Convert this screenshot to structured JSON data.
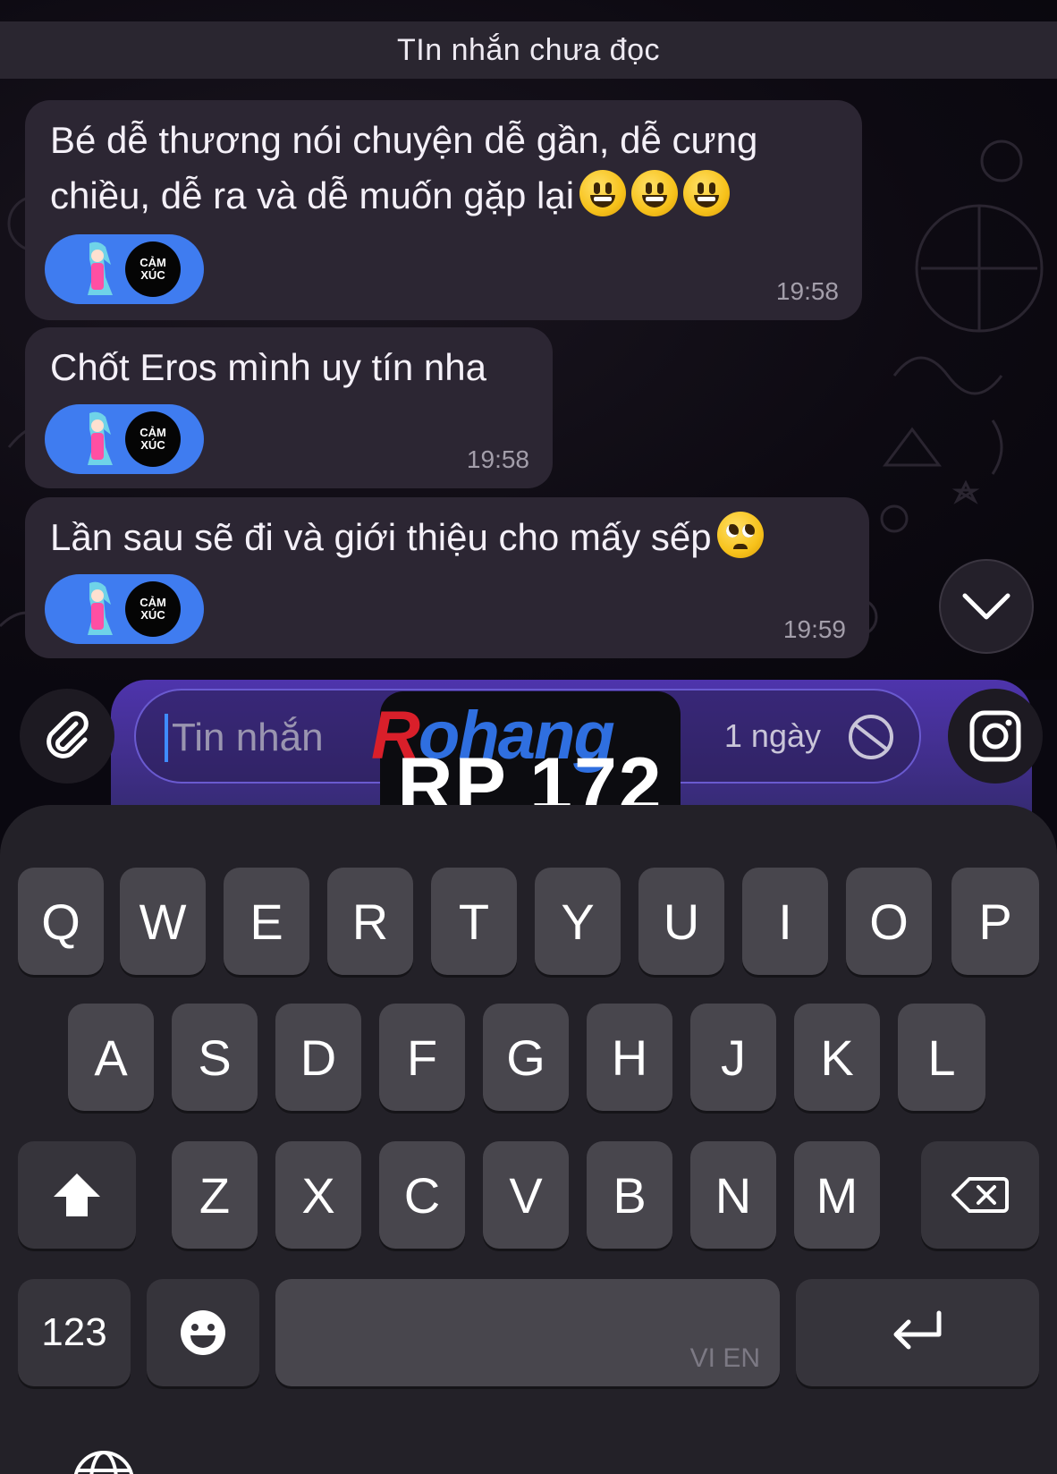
{
  "banner": {
    "unread_label": "TIn nhắn chưa đọc"
  },
  "messages": [
    {
      "text": "Bé dễ thương nói chuyện dễ gần, dễ cưng chiều, dễ ra và dễ muốn gặp lại",
      "emojis": [
        "grinning-face",
        "grinning-face",
        "grinning-face"
      ],
      "time": "19:58",
      "reaction_badge": [
        "CẢM",
        "XÚC"
      ]
    },
    {
      "text": "Chốt Eros mình uy tín nha",
      "emojis": [],
      "time": "19:58",
      "reaction_badge": [
        "CẢM",
        "XÚC"
      ]
    },
    {
      "text": "Lần sau sẽ đi và giới thiệu cho mấy sếp",
      "emojis": [
        "pleading-face"
      ],
      "time": "19:59",
      "reaction_badge": [
        "CẢM",
        "XÚC"
      ]
    }
  ],
  "composer": {
    "placeholder": "Tin nhắn",
    "ttl_label": "1 ngày"
  },
  "watermark": {
    "logo_r": "R",
    "logo_rest": "ohang",
    "caption": "RP 172"
  },
  "keyboard": {
    "row1": [
      "Q",
      "W",
      "E",
      "R",
      "T",
      "Y",
      "U",
      "I",
      "O",
      "P"
    ],
    "row2": [
      "A",
      "S",
      "D",
      "F",
      "G",
      "H",
      "J",
      "K",
      "L"
    ],
    "row3": [
      "Z",
      "X",
      "C",
      "V",
      "B",
      "N",
      "M"
    ],
    "numbers_label": "123",
    "language_label": "VI EN"
  },
  "colors": {
    "accent": "#3f7cf0",
    "bubble": "#2c2633",
    "key": "#48464d",
    "panel": "#5a3cc8"
  }
}
